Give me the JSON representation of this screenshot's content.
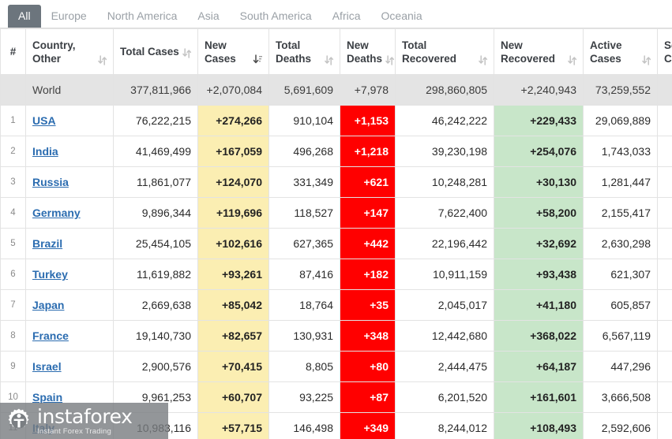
{
  "tabs": [
    {
      "label": "All",
      "active": true
    },
    {
      "label": "Europe",
      "active": false
    },
    {
      "label": "North America",
      "active": false
    },
    {
      "label": "Asia",
      "active": false
    },
    {
      "label": "South America",
      "active": false
    },
    {
      "label": "Africa",
      "active": false
    },
    {
      "label": "Oceania",
      "active": false
    }
  ],
  "table": {
    "columns": [
      {
        "key": "idx",
        "label": "#",
        "sortable": false,
        "sort": "none"
      },
      {
        "key": "country",
        "label": "Country, Other",
        "sortable": true,
        "sort": "none"
      },
      {
        "key": "total_cases",
        "label": "Total Cases",
        "sortable": true,
        "sort": "none"
      },
      {
        "key": "new_cases",
        "label": "New Cases",
        "sortable": true,
        "sort": "desc"
      },
      {
        "key": "total_deaths",
        "label": "Total Deaths",
        "sortable": true,
        "sort": "none"
      },
      {
        "key": "new_deaths",
        "label": "New Deaths",
        "sortable": true,
        "sort": "none"
      },
      {
        "key": "total_recovered",
        "label": "Total Recovered",
        "sortable": true,
        "sort": "none"
      },
      {
        "key": "new_recovered",
        "label": "New Recovered",
        "sortable": true,
        "sort": "none"
      },
      {
        "key": "active_cases",
        "label": "Active Cases",
        "sortable": true,
        "sort": "none"
      },
      {
        "key": "serious_critical",
        "label": "Serious, Critical",
        "sortable": true,
        "sort": "none"
      }
    ],
    "world_row": {
      "idx": "",
      "country": "World",
      "total_cases": "377,811,966",
      "new_cases": "+2,070,084",
      "total_deaths": "5,691,609",
      "new_deaths": "+7,978",
      "total_recovered": "298,860,805",
      "new_recovered": "+2,240,943",
      "active_cases": "73,259,552",
      "serious_critical": ""
    },
    "rows": [
      {
        "idx": "1",
        "country": "USA",
        "total_cases": "76,222,215",
        "new_cases": "+274,266",
        "total_deaths": "910,104",
        "new_deaths": "+1,153",
        "total_recovered": "46,242,222",
        "new_recovered": "+229,433",
        "active_cases": "29,069,889",
        "serious_critical": ""
      },
      {
        "idx": "2",
        "country": "India",
        "total_cases": "41,469,499",
        "new_cases": "+167,059",
        "total_deaths": "496,268",
        "new_deaths": "+1,218",
        "total_recovered": "39,230,198",
        "new_recovered": "+254,076",
        "active_cases": "1,743,033",
        "serious_critical": ""
      },
      {
        "idx": "3",
        "country": "Russia",
        "total_cases": "11,861,077",
        "new_cases": "+124,070",
        "total_deaths": "331,349",
        "new_deaths": "+621",
        "total_recovered": "10,248,281",
        "new_recovered": "+30,130",
        "active_cases": "1,281,447",
        "serious_critical": ""
      },
      {
        "idx": "4",
        "country": "Germany",
        "total_cases": "9,896,344",
        "new_cases": "+119,696",
        "total_deaths": "118,527",
        "new_deaths": "+147",
        "total_recovered": "7,622,400",
        "new_recovered": "+58,200",
        "active_cases": "2,155,417",
        "serious_critical": ""
      },
      {
        "idx": "5",
        "country": "Brazil",
        "total_cases": "25,454,105",
        "new_cases": "+102,616",
        "total_deaths": "627,365",
        "new_deaths": "+442",
        "total_recovered": "22,196,442",
        "new_recovered": "+32,692",
        "active_cases": "2,630,298",
        "serious_critical": ""
      },
      {
        "idx": "6",
        "country": "Turkey",
        "total_cases": "11,619,882",
        "new_cases": "+93,261",
        "total_deaths": "87,416",
        "new_deaths": "+182",
        "total_recovered": "10,911,159",
        "new_recovered": "+93,438",
        "active_cases": "621,307",
        "serious_critical": ""
      },
      {
        "idx": "7",
        "country": "Japan",
        "total_cases": "2,669,638",
        "new_cases": "+85,042",
        "total_deaths": "18,764",
        "new_deaths": "+35",
        "total_recovered": "2,045,017",
        "new_recovered": "+41,180",
        "active_cases": "605,857",
        "serious_critical": ""
      },
      {
        "idx": "8",
        "country": "France",
        "total_cases": "19,140,730",
        "new_cases": "+82,657",
        "total_deaths": "130,931",
        "new_deaths": "+348",
        "total_recovered": "12,442,680",
        "new_recovered": "+368,022",
        "active_cases": "6,567,119",
        "serious_critical": ""
      },
      {
        "idx": "9",
        "country": "Israel",
        "total_cases": "2,900,576",
        "new_cases": "+70,415",
        "total_deaths": "8,805",
        "new_deaths": "+80",
        "total_recovered": "2,444,475",
        "new_recovered": "+64,187",
        "active_cases": "447,296",
        "serious_critical": ""
      },
      {
        "idx": "10",
        "country": "Spain",
        "total_cases": "9,961,253",
        "new_cases": "+60,707",
        "total_deaths": "93,225",
        "new_deaths": "+87",
        "total_recovered": "6,201,520",
        "new_recovered": "+161,601",
        "active_cases": "3,666,508",
        "serious_critical": ""
      },
      {
        "idx": "11",
        "country": "Italy",
        "total_cases": "10,983,116",
        "new_cases": "+57,715",
        "total_deaths": "146,498",
        "new_deaths": "+349",
        "total_recovered": "8,244,012",
        "new_recovered": "+108,493",
        "active_cases": "2,592,606",
        "serious_critical": ""
      }
    ]
  },
  "watermark": {
    "name": "instaforex",
    "tagline": "Instant Forex Trading"
  },
  "colors": {
    "active_tab_bg": "#6c757d",
    "new_cases_bg": "#fbeeb2",
    "new_deaths_bg": "#ff0000",
    "new_recovered_bg": "#c8e6c9",
    "world_row_bg": "#e4e4e4",
    "link": "#2b6cb0"
  }
}
